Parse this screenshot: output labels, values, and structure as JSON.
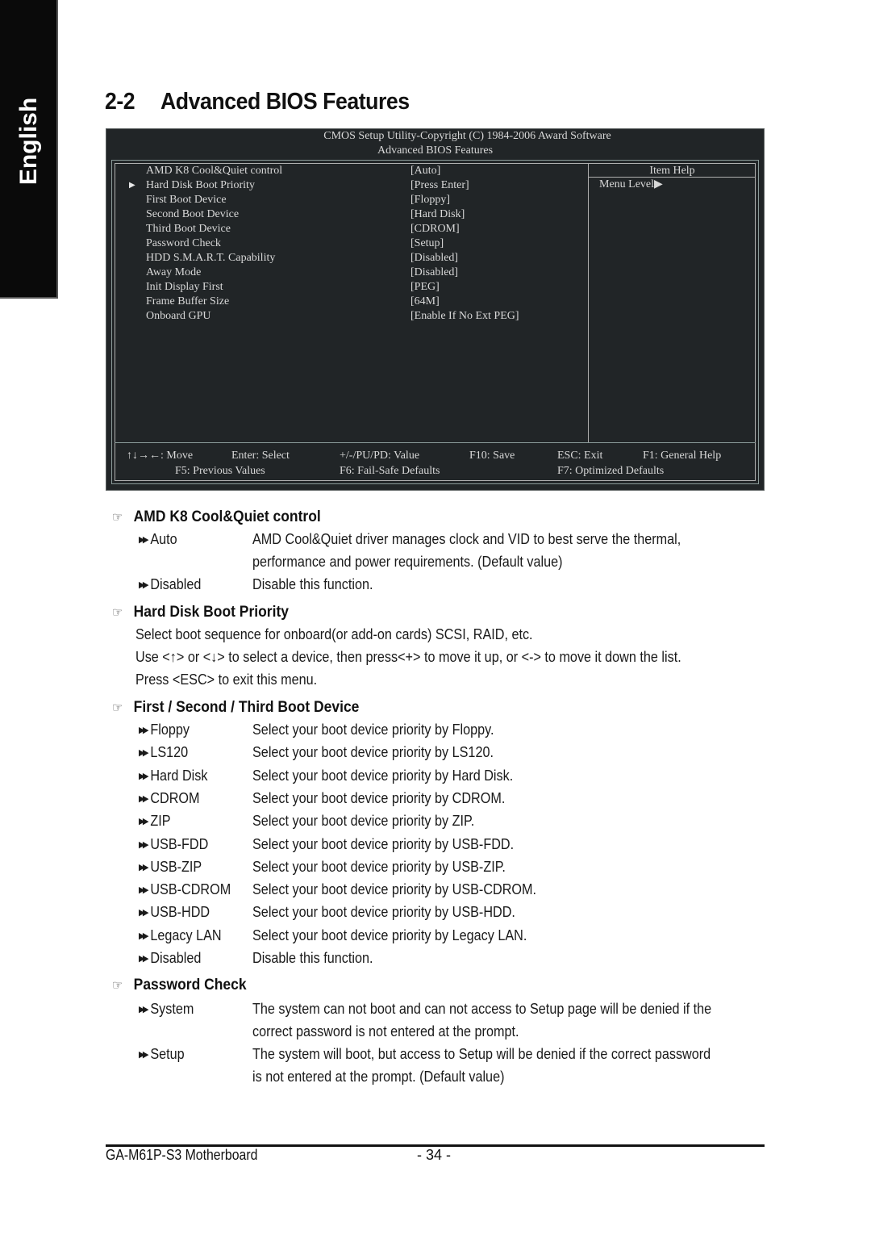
{
  "language_tab": "English",
  "page_title": {
    "number": "2-2",
    "text": "Advanced BIOS Features"
  },
  "bios": {
    "header_line1": "CMOS Setup Utility-Copyright (C) 1984-2006 Award Software",
    "header_line2": "Advanced BIOS Features",
    "items": [
      {
        "label": "AMD K8 Cool&Quiet control",
        "value": "[Auto]",
        "submenu": false
      },
      {
        "label": "Hard Disk Boot Priority",
        "value": "[Press Enter]",
        "submenu": true
      },
      {
        "label": "First Boot Device",
        "value": "[Floppy]",
        "submenu": false
      },
      {
        "label": "Second Boot Device",
        "value": "[Hard Disk]",
        "submenu": false
      },
      {
        "label": "Third Boot Device",
        "value": "[CDROM]",
        "submenu": false
      },
      {
        "label": "Password Check",
        "value": "[Setup]",
        "submenu": false
      },
      {
        "label": "HDD S.M.A.R.T. Capability",
        "value": "[Disabled]",
        "submenu": false
      },
      {
        "label": "Away Mode",
        "value": "[Disabled]",
        "submenu": false
      },
      {
        "label": "Init Display First",
        "value": "[PEG]",
        "submenu": false
      },
      {
        "label": "Frame Buffer Size",
        "value": "[64M]",
        "submenu": false
      },
      {
        "label": "Onboard GPU",
        "value": "[Enable If No Ext PEG]",
        "submenu": false
      }
    ],
    "submenu_arrow": "▶",
    "item_help_title": "Item Help",
    "item_help_text": "Menu Level▶",
    "keys": {
      "move": "↑↓→←: Move",
      "enter": "Enter: Select",
      "value": "+/-/PU/PD: Value",
      "save": "F10: Save",
      "exit": "ESC: Exit",
      "help": "F1: General Help",
      "previous": "F5: Previous Values",
      "failsafe": "F6: Fail-Safe Defaults",
      "optimized": "F7: Optimized Defaults"
    }
  },
  "bullet_icon": "☞",
  "option_icon": "▶▶",
  "sections": {
    "cool_quiet": {
      "title": "AMD K8 Cool&Quiet control",
      "options": [
        {
          "name": "Auto",
          "desc": [
            "AMD Cool&Quiet driver manages clock and VID to best serve the thermal,",
            "performance and power requirements. (Default value)"
          ]
        },
        {
          "name": "Disabled",
          "desc": [
            "Disable this function."
          ]
        }
      ]
    },
    "hdd_priority": {
      "title": "Hard Disk Boot Priority",
      "lines": [
        "Select boot sequence for onboard(or add-on cards) SCSI, RAID, etc.",
        "Use <↑> or <↓> to select a device, then press<+> to move it up, or <-> to move it down the list.",
        "Press <ESC> to exit this menu."
      ]
    },
    "boot_device": {
      "title": "First / Second / Third Boot Device",
      "options": [
        {
          "name": "Floppy",
          "desc": "Select your boot device priority by Floppy."
        },
        {
          "name": "LS120",
          "desc": "Select your boot device priority by LS120."
        },
        {
          "name": "Hard Disk",
          "desc": "Select your boot device priority by Hard Disk."
        },
        {
          "name": "CDROM",
          "desc": "Select your boot device priority by CDROM."
        },
        {
          "name": "ZIP",
          "desc": "Select your boot device priority by ZIP."
        },
        {
          "name": "USB-FDD",
          "desc": "Select your boot device priority by USB-FDD."
        },
        {
          "name": "USB-ZIP",
          "desc": "Select your boot device priority by USB-ZIP."
        },
        {
          "name": "USB-CDROM",
          "desc": "Select your boot device priority by USB-CDROM."
        },
        {
          "name": "USB-HDD",
          "desc": "Select your boot device priority by USB-HDD."
        },
        {
          "name": "Legacy LAN",
          "desc": "Select your boot device priority by Legacy LAN."
        },
        {
          "name": "Disabled",
          "desc": "Disable this function."
        }
      ]
    },
    "password_check": {
      "title": "Password Check",
      "options": [
        {
          "name": "System",
          "desc": [
            "The system can not boot and can not access to Setup page will be denied if the",
            "correct password is not entered at the prompt."
          ]
        },
        {
          "name": "Setup",
          "desc": [
            "The system will boot, but access to Setup will be denied if the correct password",
            "is not entered at the prompt. (Default value)"
          ]
        }
      ]
    }
  },
  "footer": {
    "product": "GA-M61P-S3 Motherboard",
    "page": "- 34 -"
  }
}
